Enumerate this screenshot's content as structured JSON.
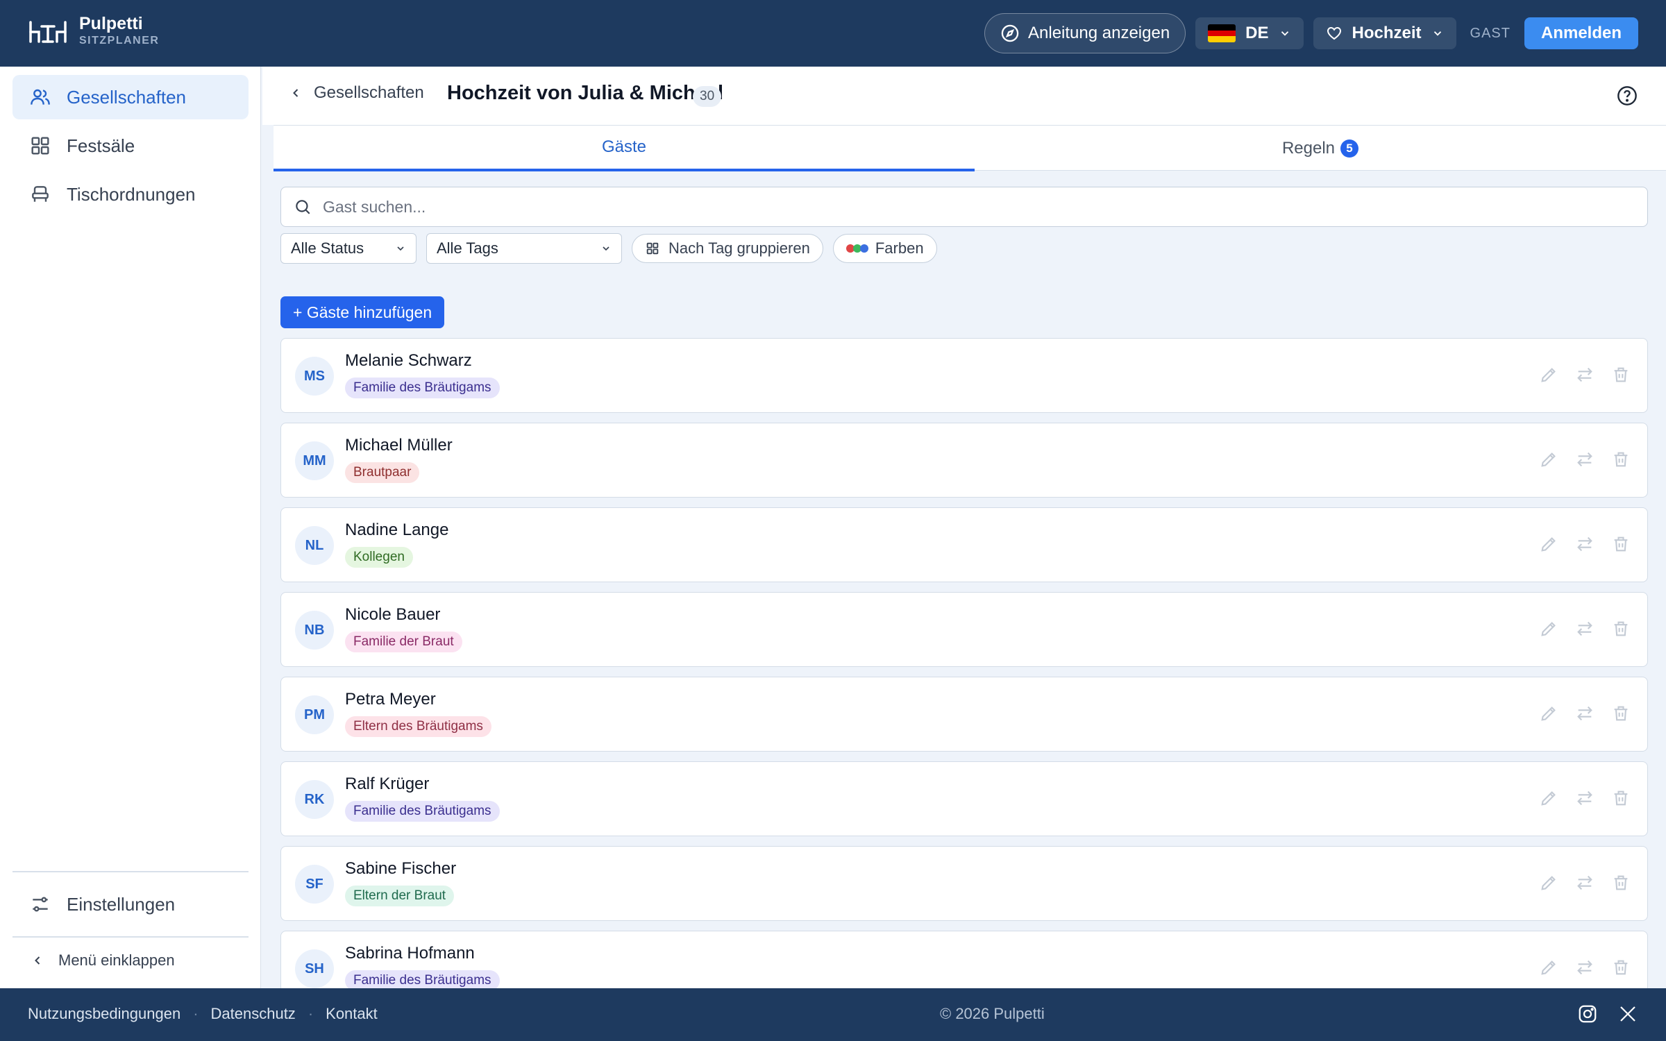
{
  "header": {
    "brand_name": "Pulpetti",
    "brand_sub": "SITZPLANER",
    "guide_label": "Anleitung anzeigen",
    "lang_code": "DE",
    "event_type": "Hochzeit",
    "guest_label": "GAST",
    "login_label": "Anmelden"
  },
  "sidebar": {
    "items": [
      {
        "label": "Gesellschaften",
        "icon": "users-icon",
        "active": true
      },
      {
        "label": "Festsäle",
        "icon": "grid-icon",
        "active": false
      },
      {
        "label": "Tischordnungen",
        "icon": "seat-icon",
        "active": false
      }
    ],
    "settings_label": "Einstellungen",
    "collapse_label": "Menü einklappen"
  },
  "main": {
    "back_label": "Gesellschaften",
    "title": "Hochzeit von Julia & Michael",
    "guest_count": "30",
    "tabs": [
      {
        "label": "Gäste",
        "active": true
      },
      {
        "label": "Regeln",
        "badge": "5",
        "active": false
      }
    ],
    "search_placeholder": "Gast suchen...",
    "filter_status": "Alle Status",
    "filter_tags": "Alle Tags",
    "group_by_tag": "Nach Tag gruppieren",
    "colors_label": "Farben",
    "add_guests": "+ Gäste hinzufügen"
  },
  "guests": [
    {
      "initials": "MS",
      "name": "Melanie Schwarz",
      "tag": "Familie des Bräutigams",
      "tag_bg": "#e6e4fb",
      "tag_fg": "#3b2f8f"
    },
    {
      "initials": "MM",
      "name": "Michael Müller",
      "tag": "Brautpaar",
      "tag_bg": "#fbe3e3",
      "tag_fg": "#8f2f2f"
    },
    {
      "initials": "NL",
      "name": "Nadine Lange",
      "tag": "Kollegen",
      "tag_bg": "#e5f6e0",
      "tag_fg": "#2f6b23"
    },
    {
      "initials": "NB",
      "name": "Nicole Bauer",
      "tag": "Familie der Braut",
      "tag_bg": "#fbe2f1",
      "tag_fg": "#8a2a66"
    },
    {
      "initials": "PM",
      "name": "Petra Meyer",
      "tag": "Eltern des Bräutigams",
      "tag_bg": "#fde2e8",
      "tag_fg": "#8f2f45"
    },
    {
      "initials": "RK",
      "name": "Ralf Krüger",
      "tag": "Familie des Bräutigams",
      "tag_bg": "#e6e4fb",
      "tag_fg": "#3b2f8f"
    },
    {
      "initials": "SF",
      "name": "Sabine Fischer",
      "tag": "Eltern der Braut",
      "tag_bg": "#dff5ec",
      "tag_fg": "#1f6b4e"
    },
    {
      "initials": "SH",
      "name": "Sabrina Hofmann",
      "tag": "Familie des Bräutigams",
      "tag_bg": "#e6e4fb",
      "tag_fg": "#3b2f8f"
    }
  ],
  "footer": {
    "links": [
      "Nutzungsbedingungen",
      "Datenschutz",
      "Kontakt"
    ],
    "copyright": "© 2026 Pulpetti"
  },
  "colors": {
    "header_bg": "#1e3a5f",
    "accent": "#2563eb",
    "page_bg": "#eef3fa"
  }
}
